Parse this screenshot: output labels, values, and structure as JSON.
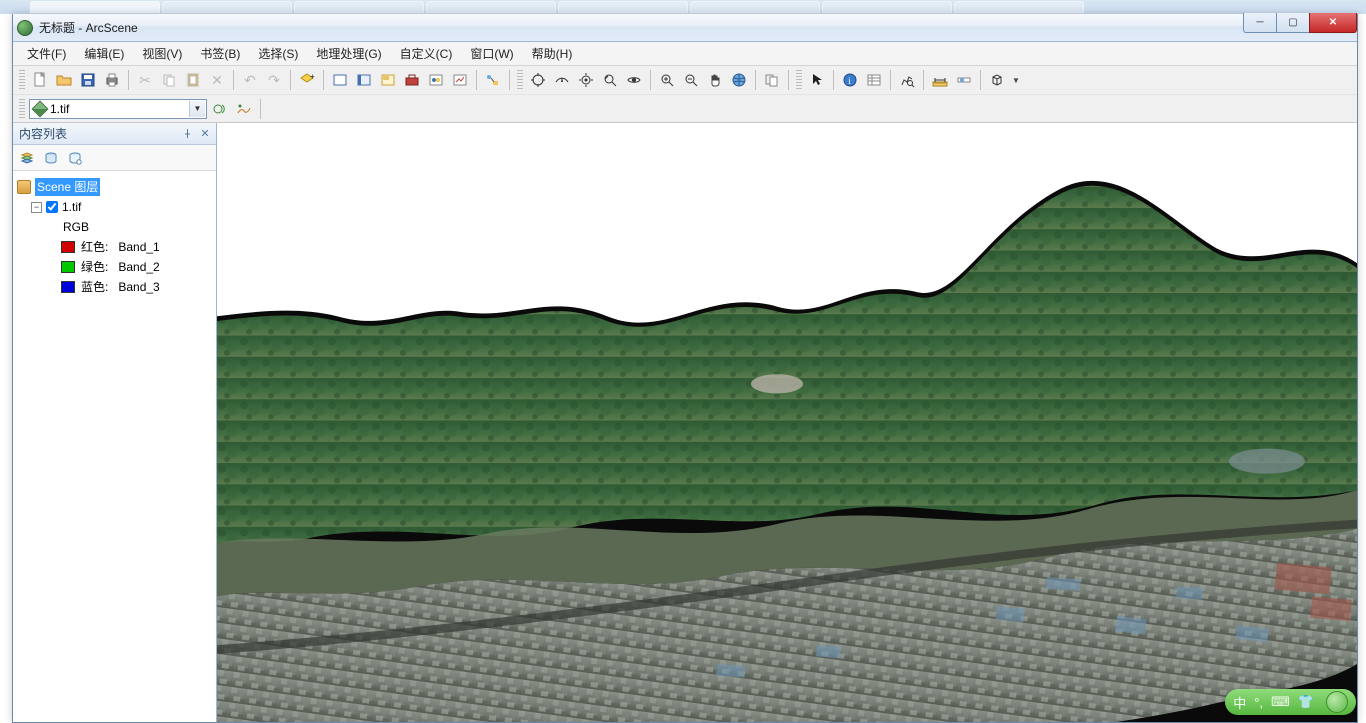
{
  "window": {
    "title": "无标题 - ArcScene"
  },
  "menus": {
    "file": "文件(F)",
    "edit": "编辑(E)",
    "view": "视图(V)",
    "bookmarks": "书签(B)",
    "selection": "选择(S)",
    "geoprocessing": "地理处理(G)",
    "customize": "自定义(C)",
    "windows": "窗口(W)",
    "help": "帮助(H)"
  },
  "layer_combo": {
    "value": "1.tif"
  },
  "toc": {
    "title": "内容列表",
    "root": "Scene 图层",
    "layer": "1.tif",
    "rgb_label": "RGB",
    "red": {
      "label": "红色:",
      "band": "Band_1"
    },
    "green": {
      "label": "绿色:",
      "band": "Band_2"
    },
    "blue": {
      "label": "蓝色:",
      "band": "Band_3"
    }
  },
  "ime": {
    "lang": "中",
    "punct": "°,"
  }
}
